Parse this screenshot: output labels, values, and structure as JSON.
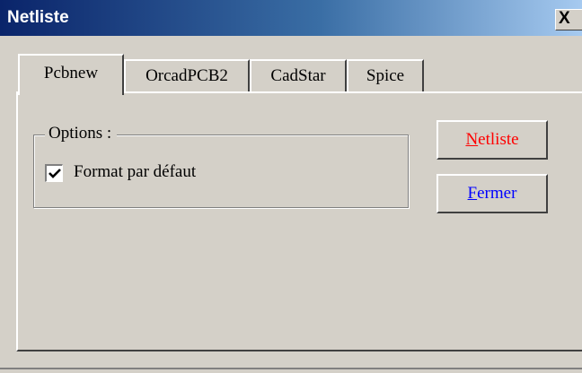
{
  "window": {
    "title": "Netliste",
    "close_glyph": "X"
  },
  "tabs": [
    {
      "label": "Pcbnew",
      "active": true
    },
    {
      "label": "OrcadPCB2",
      "active": false
    },
    {
      "label": "CadStar",
      "active": false
    },
    {
      "label": "Spice",
      "active": false
    }
  ],
  "options": {
    "group_title": "Options :",
    "format_default": {
      "label": "Format par défaut",
      "checked": true
    }
  },
  "buttons": {
    "netliste": {
      "mnemonic": "N",
      "rest": "etliste",
      "color": "#ff0000"
    },
    "fermer": {
      "mnemonic": "F",
      "rest": "ermer",
      "color": "#0000ff"
    }
  },
  "colors": {
    "face": "#d4d0c8",
    "title_start": "#0a246a",
    "title_end": "#a6caf0"
  }
}
